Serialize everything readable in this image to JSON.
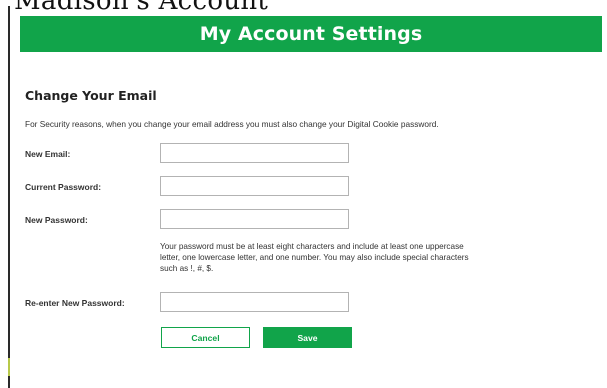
{
  "top_cropped_text": "Madison's Account",
  "banner": {
    "title": "My Account Settings"
  },
  "section": {
    "title": "Change Your Email",
    "intro": "For Security reasons, when you change your email address you must also change your Digital Cookie password."
  },
  "fields": {
    "new_email": {
      "label": "New Email:",
      "value": ""
    },
    "current_password": {
      "label": "Current Password:",
      "value": ""
    },
    "new_password": {
      "label": "New Password:",
      "value": ""
    },
    "reenter_password": {
      "label": "Re-enter New Password:",
      "value": ""
    }
  },
  "password_help": "Your password must be at least eight characters and include at least one uppercase letter, one lowercase letter, and one number. You may also include special characters such as !, #, $.",
  "buttons": {
    "cancel_label": "Cancel",
    "save_label": "Save"
  },
  "colors": {
    "brand_green": "#11a44a",
    "page_background": "#ffffff"
  }
}
